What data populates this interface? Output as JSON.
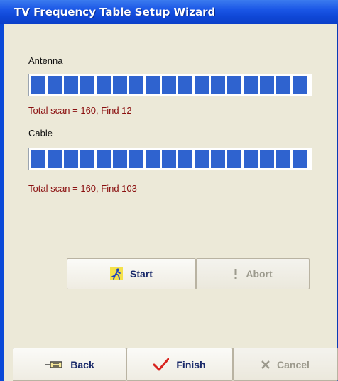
{
  "window": {
    "title": "TV Frequency Table Setup Wizard"
  },
  "antenna": {
    "label": "Antenna",
    "progress": 1.0,
    "result": "Total scan = 160, Find 12"
  },
  "cable": {
    "label": "Cable",
    "progress": 1.0,
    "result": "Total scan = 160, Find 103"
  },
  "scan_buttons": {
    "start_label": "Start",
    "abort_label": "Abort"
  },
  "footer": {
    "back_label": "Back",
    "finish_label": "Finish",
    "cancel_label": "Cancel"
  },
  "colors": {
    "progress_fill": "#2f63cf",
    "result_text": "#8a0f0f",
    "title_bar": "#0f47d6"
  },
  "icons": {
    "start": "running-man-icon",
    "abort": "exclamation-icon",
    "back": "pointing-hand-icon",
    "finish": "checkmark-icon",
    "cancel": "x-icon"
  }
}
